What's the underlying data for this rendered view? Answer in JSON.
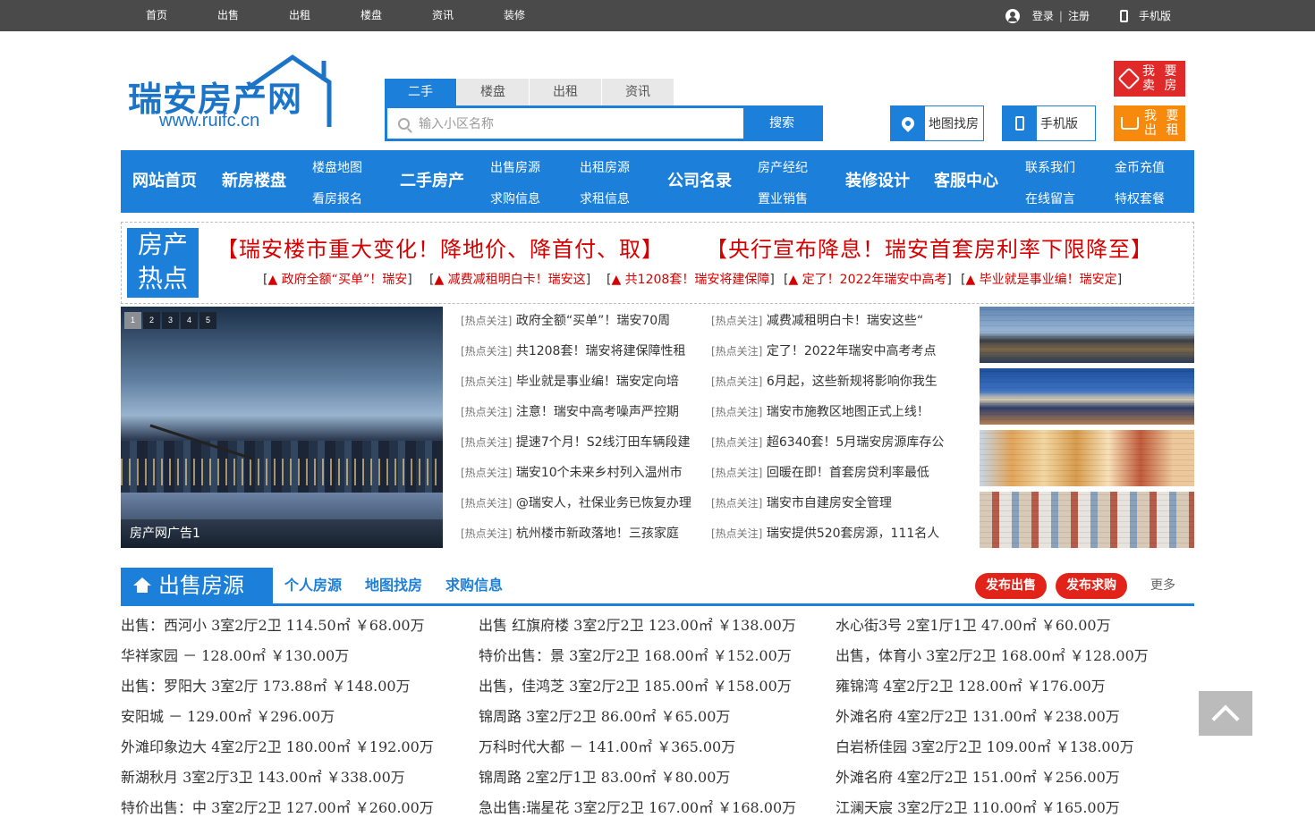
{
  "topnav": [
    "首页",
    "出售",
    "出租",
    "楼盘",
    "资讯",
    "装修"
  ],
  "top_right": {
    "login": "登录",
    "sep": "|",
    "register": "注册",
    "mobile": "手机版"
  },
  "logo": {
    "name": "瑞安房产网",
    "url": "www.ruifc.cn"
  },
  "search": {
    "tabs": [
      "二手",
      "楼盘",
      "出租",
      "资讯"
    ],
    "placeholder": "输入小区名称",
    "button": "搜索"
  },
  "header_boxes": {
    "map": "地图找房",
    "mobile": "手机版"
  },
  "action_buttons": {
    "sell_line1": "我 要",
    "sell_line2": "卖 房",
    "rent_line1": "我 要",
    "rent_line2": "出 租"
  },
  "mainnav": {
    "home": "网站首页",
    "new": "新房楼盘",
    "loupan_map": "楼盘地图",
    "kanfang": "看房报名",
    "second": "二手房产",
    "sale_src": "出售房源",
    "buy_info": "求购信息",
    "rent_src": "出租房源",
    "rentwant": "求租信息",
    "company": "公司名录",
    "agent": "房产经纪",
    "zhiye": "置业销售",
    "deco": "装修设计",
    "service": "客服中心",
    "contact": "联系我们",
    "msg": "在线留言",
    "coin": "金币充值",
    "vip": "特权套餐"
  },
  "hot": {
    "label1": "房产",
    "label2": "热点",
    "big1": "【瑞安楼市重大变化！降地价、降首付、取】",
    "big2": "【央行宣布降息！瑞安首套房利率下限降至】",
    "small": [
      "▲ 政府全额“买单”！瑞安",
      "▲ 减费减租明白卡！瑞安这",
      "▲ 共1208套！瑞安将建保障",
      "▲ 定了！2022年瑞安中高考",
      "▲ 毕业就是事业编！瑞安定"
    ]
  },
  "slider": {
    "pages": [
      "1",
      "2",
      "3",
      "4",
      "5"
    ],
    "caption": "房产网广告1"
  },
  "news_tag": "[热点关注]",
  "news_left": [
    "政府全额“买单”！瑞安70周",
    "共1208套！瑞安将建保障性租",
    "毕业就是事业编！瑞安定向培",
    "注意！瑞安中高考噪声严控期",
    "提速7个月！S2线汀田车辆段建",
    "瑞安10个未来乡村列入温州市",
    "@瑞安人，社保业务已恢复办理",
    "杭州楼市新政落地！三孩家庭"
  ],
  "news_right": [
    "减费减租明白卡！瑞安这些“",
    "定了！2022年瑞安中高考考点",
    "6月起，这些新规将影响你我生",
    "瑞安市施教区地图正式上线！",
    "超6340套！5月瑞安房源库存公",
    "回暖在即！首套房贷利率最低",
    "瑞安市自建房安全管理",
    "瑞安提供520套房源，111名人"
  ],
  "sale": {
    "title": "出售房源",
    "tabs": [
      "个人房源",
      "地图找房",
      "求购信息"
    ],
    "publish_sale": "发布出售",
    "publish_buy": "发布求购",
    "more": "更多"
  },
  "list_col1": [
    "出售：西河小 3室2厅2卫 114.50㎡ ￥68.00万",
    "华祥家园 － 128.00㎡ ￥130.00万",
    "出售：罗阳大 3室2厅 173.88㎡ ￥148.00万",
    "安阳城 － 129.00㎡ ￥296.00万",
    "外滩印象边大 4室2厅2卫 180.00㎡ ￥192.00万",
    "新湖秋月 3室2厅3卫 143.00㎡ ￥338.00万",
    "特价出售：中 3室2厅2卫 127.00㎡ ￥260.00万"
  ],
  "list_col2": [
    "出售 红旗府楼 3室2厅2卫 123.00㎡ ￥138.00万",
    "特价出售：景 3室2厅2卫 168.00㎡ ￥152.00万",
    "出售，佳鸿芝 3室2厅2卫 185.00㎡ ￥158.00万",
    "锦周路 3室2厅2卫 86.00㎡ ￥65.00万",
    "万科时代大都 － 141.00㎡ ￥365.00万",
    "锦周路 2室2厅1卫 83.00㎡ ￥80.00万",
    "急出售:瑞星花 3室2厅2卫 167.00㎡ ￥168.00万"
  ],
  "list_col3": [
    "水心街3号 2室1厅1卫 47.00㎡ ￥60.00万",
    "出售，体育小 3室2厅2卫 168.00㎡ ￥128.00万",
    "雍锦湾 4室2厅2卫 128.00㎡ ￥176.00万",
    "外滩名府 4室2厅2卫 131.00㎡ ￥238.00万",
    "白岩桥佳园 3室2厅2卫 109.00㎡ ￥138.00万",
    "外滩名府 4室2厅2卫 151.00㎡ ￥256.00万",
    "江澜天宸 3室2厅2卫 110.00㎡ ￥165.00万"
  ],
  "colors": {
    "brand_blue": "#1c7fd9",
    "hot_red": "#d50000",
    "btn_red": "#e2231a",
    "topbar": "#4a4a4a"
  }
}
